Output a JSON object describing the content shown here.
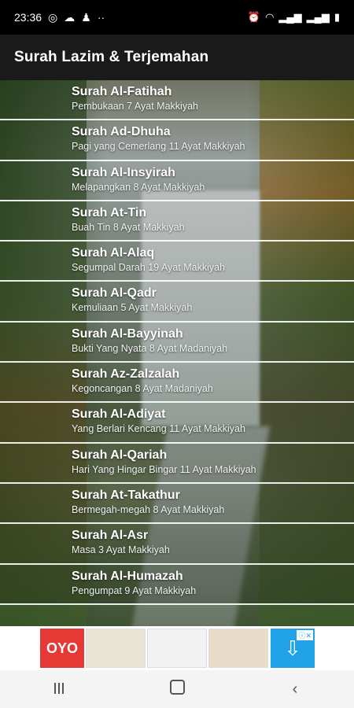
{
  "status_bar": {
    "time": "23:36",
    "left_icons": [
      "instagram-icon",
      "cloud-icon",
      "app-icon",
      "more-icon"
    ],
    "right_icons": [
      "alarm-icon",
      "wifi-icon",
      "signal-icon",
      "signal-icon",
      "battery-icon"
    ]
  },
  "app_bar": {
    "title": "Surah Lazim & Terjemahan"
  },
  "surah_list": [
    {
      "title": "Surah Al-Fatihah",
      "subtitle": "Pembukaan 7 Ayat Makkiyah"
    },
    {
      "title": "Surah Ad-Dhuha",
      "subtitle": "Pagi yang Cemerlang 11 Ayat Makkiyah"
    },
    {
      "title": "Surah Al-Insyirah",
      "subtitle": "Melapangkan 8 Ayat Makkiyah"
    },
    {
      "title": "Surah At-Tin",
      "subtitle": "Buah Tin 8 Ayat Makkiyah"
    },
    {
      "title": "Surah Al-Alaq",
      "subtitle": "Segumpal Darah 19 Ayat Makkiyah"
    },
    {
      "title": "Surah Al-Qadr",
      "subtitle": "Kemuliaan 5 Ayat Makkiyah"
    },
    {
      "title": "Surah Al-Bayyinah",
      "subtitle": "Bukti Yang Nyata 8 Ayat Madaniyah"
    },
    {
      "title": "Surah Az-Zalzalah",
      "subtitle": "Kegoncangan 8 Ayat Madaniyah"
    },
    {
      "title": "Surah Al-Adiyat",
      "subtitle": "Yang Berlari Kencang 11 Ayat Makkiyah"
    },
    {
      "title": "Surah Al-Qariah",
      "subtitle": "Hari Yang Hingar Bingar 11 Ayat Makkiyah"
    },
    {
      "title": "Surah At-Takathur",
      "subtitle": "Bermegah-megah 8 Ayat Makkiyah"
    },
    {
      "title": "Surah Al-Asr",
      "subtitle": "Masa 3 Ayat Makkiyah"
    },
    {
      "title": "Surah Al-Humazah",
      "subtitle": "Pengumpat 9 Ayat Makkiyah"
    }
  ],
  "ad_banner": {
    "logo_text": "OYO"
  }
}
